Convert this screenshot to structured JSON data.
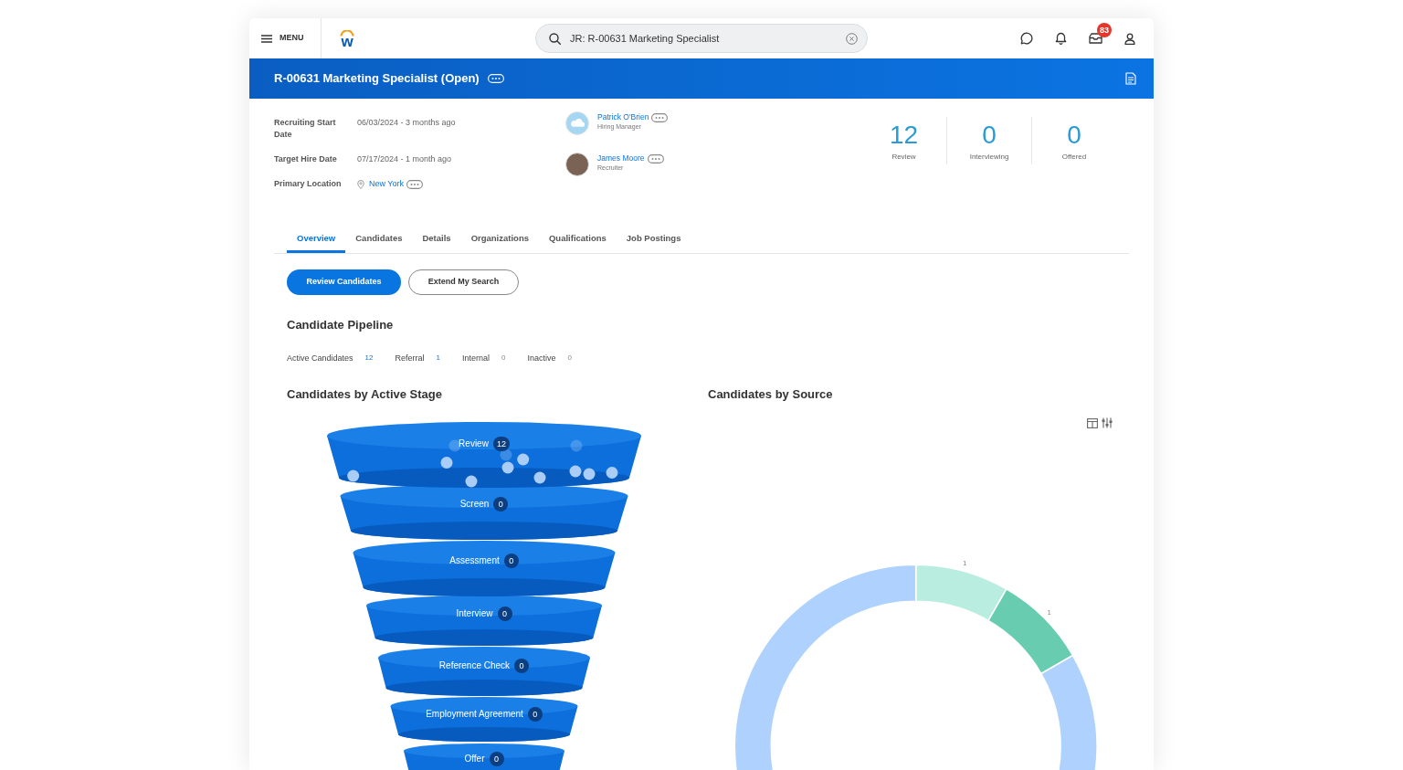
{
  "top_bar": {
    "menu_label": "MENU",
    "logo_letter": "w",
    "search": {
      "value": "JR: R-00631 Marketing Specialist"
    },
    "inbox_badge": "83"
  },
  "header": {
    "title": "R-00631 Marketing Specialist (Open)"
  },
  "details": [
    {
      "kind": "text",
      "label": "Recruiting Start Date",
      "value": "06/03/2024 - 3 months ago"
    },
    {
      "kind": "text",
      "label": "Target Hire Date",
      "value": "07/17/2024 - 1 month ago"
    },
    {
      "kind": "location",
      "label": "Primary Location",
      "value": "New York"
    }
  ],
  "people": [
    {
      "kind": "default",
      "name": "Patrick O'Brien",
      "role": "Hiring Manager"
    },
    {
      "kind": "photo",
      "name": "James Moore",
      "role": "Recruiter"
    }
  ],
  "stats": [
    {
      "value": "12",
      "label": "Review"
    },
    {
      "value": "0",
      "label": "Interviewing"
    },
    {
      "value": "0",
      "label": "Offered"
    }
  ],
  "tabs": [
    {
      "label": "Overview",
      "selected": true
    },
    {
      "label": "Candidates",
      "selected": false
    },
    {
      "label": "Details",
      "selected": false
    },
    {
      "label": "Organizations",
      "selected": false
    },
    {
      "label": "Qualifications",
      "selected": false
    },
    {
      "label": "Job Postings",
      "selected": false
    }
  ],
  "buttons": [
    {
      "label": "Review Candidates",
      "kind": "primary"
    },
    {
      "label": "Extend My Search",
      "kind": "secondary"
    }
  ],
  "pipeline": {
    "title": "Candidate Pipeline",
    "counts": [
      {
        "label": "Active Candidates",
        "count": "12",
        "link": true
      },
      {
        "label": "Referral",
        "count": "1",
        "link": true
      },
      {
        "label": "Internal",
        "count": "0",
        "link": false
      },
      {
        "label": "Inactive",
        "count": "0",
        "link": false
      }
    ]
  },
  "stage_chart": {
    "title": "Candidates by Active Stage",
    "stages": [
      {
        "label": "Review",
        "count": "12"
      },
      {
        "label": "Screen",
        "count": "0"
      },
      {
        "label": "Assessment",
        "count": "0"
      },
      {
        "label": "Interview",
        "count": "0"
      },
      {
        "label": "Reference Check",
        "count": "0"
      },
      {
        "label": "Employment Agreement",
        "count": "0"
      },
      {
        "label": "Offer",
        "count": "0"
      }
    ]
  },
  "source_chart": {
    "chart_data": {
      "type": "donut",
      "title": "Candidates by Source",
      "values": [
        1,
        1,
        10
      ],
      "colors": [
        "#b8ede0",
        "#68cdb0",
        "#aed2fd"
      ],
      "value_labels": [
        "1",
        "1",
        null
      ]
    }
  }
}
